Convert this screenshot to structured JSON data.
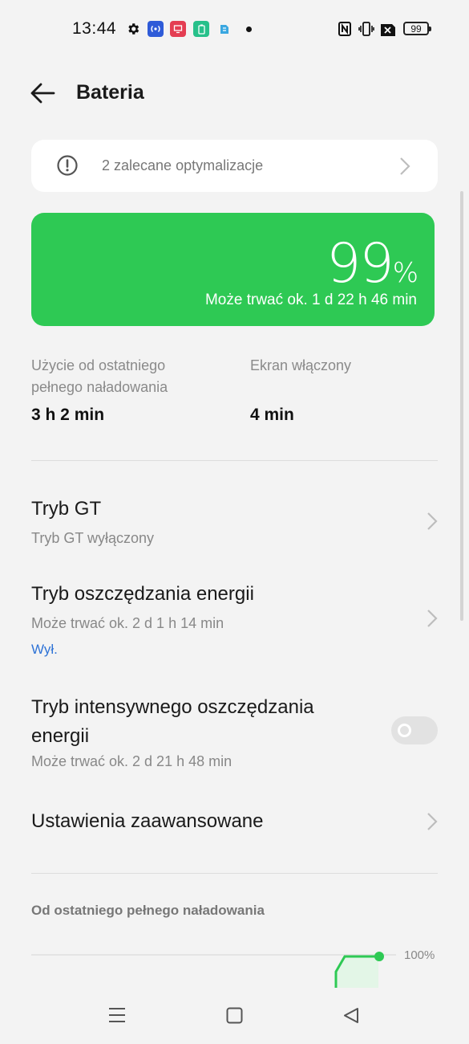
{
  "status": {
    "time": "13:44",
    "battery": "99",
    "icons": [
      "gear-icon",
      "broadcast-app-icon",
      "cast-app-icon",
      "battery-app-icon",
      "files-app-icon",
      "nfc-icon",
      "vibrate-icon",
      "no-sim-icon"
    ]
  },
  "header": {
    "title": "Bateria"
  },
  "recommend": {
    "text": "2 zalecane optymalizacje"
  },
  "battery": {
    "level": 99,
    "percent": "99",
    "unit": "%",
    "remaining": "Może trwać ok. 1 d 22 h 46 min",
    "color": "#2ec954"
  },
  "stats": {
    "usage_label_1": "Użycie od ostatniego",
    "usage_label_2": "pełnego naładowania",
    "usage_value": "3 h 2 min",
    "screen_label": "Ekran włączony",
    "screen_value": "4 min"
  },
  "settings": {
    "gt_title": "Tryb GT",
    "gt_sub": "Tryb GT wyłączony",
    "saver_title": "Tryb oszczędzania energii",
    "saver_sub": "Może trwać ok. 2 d 1 h 14 min",
    "saver_state": "Wył.",
    "intense_title_1": "Tryb intensywnego oszczędzania",
    "intense_title_2": "energii",
    "intense_sub": "Może trwać ok. 2 d 21 h 48 min",
    "intense_on": false,
    "advanced_title": "Ustawienia zaawansowane"
  },
  "history": {
    "section_title": "Od ostatniego pełnego naładowania",
    "chart_label": "100%"
  },
  "accent_link": "#2f73d6"
}
